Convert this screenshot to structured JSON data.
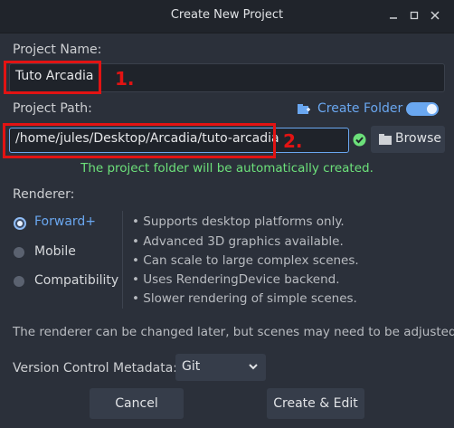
{
  "window": {
    "title": "Create New Project"
  },
  "project_name": {
    "label": "Project Name:",
    "value": "Tuto Arcadia",
    "annotation": "1."
  },
  "project_path": {
    "label": "Project Path:",
    "value": "/home/jules/Desktop/Arcadia/tuto-arcadia",
    "annotation": "2.",
    "create_folder_label": "Create Folder",
    "browse_label": "Browse",
    "status_message": "The project folder will be automatically created."
  },
  "renderer": {
    "label": "Renderer:",
    "options": [
      "Forward+",
      "Mobile",
      "Compatibility"
    ],
    "selected": "Forward+",
    "features": [
      "Supports desktop platforms only.",
      "Advanced 3D graphics available.",
      "Can scale to large complex scenes.",
      "Uses RenderingDevice backend.",
      "Slower rendering of simple scenes."
    ],
    "note": "The renderer can be changed later, but scenes may need to be adjusted."
  },
  "vcs": {
    "label": "Version Control Metadata:",
    "value": "Git"
  },
  "buttons": {
    "cancel": "Cancel",
    "create": "Create & Edit"
  },
  "colors": {
    "accent": "#6aa7f0",
    "annotation_red": "#e21313",
    "ok_green": "#6ce07a"
  },
  "icons": [
    "minimize-icon",
    "maximize-icon",
    "close-icon",
    "folder-add-icon",
    "check-icon",
    "folder-icon",
    "chevron-down-icon"
  ]
}
